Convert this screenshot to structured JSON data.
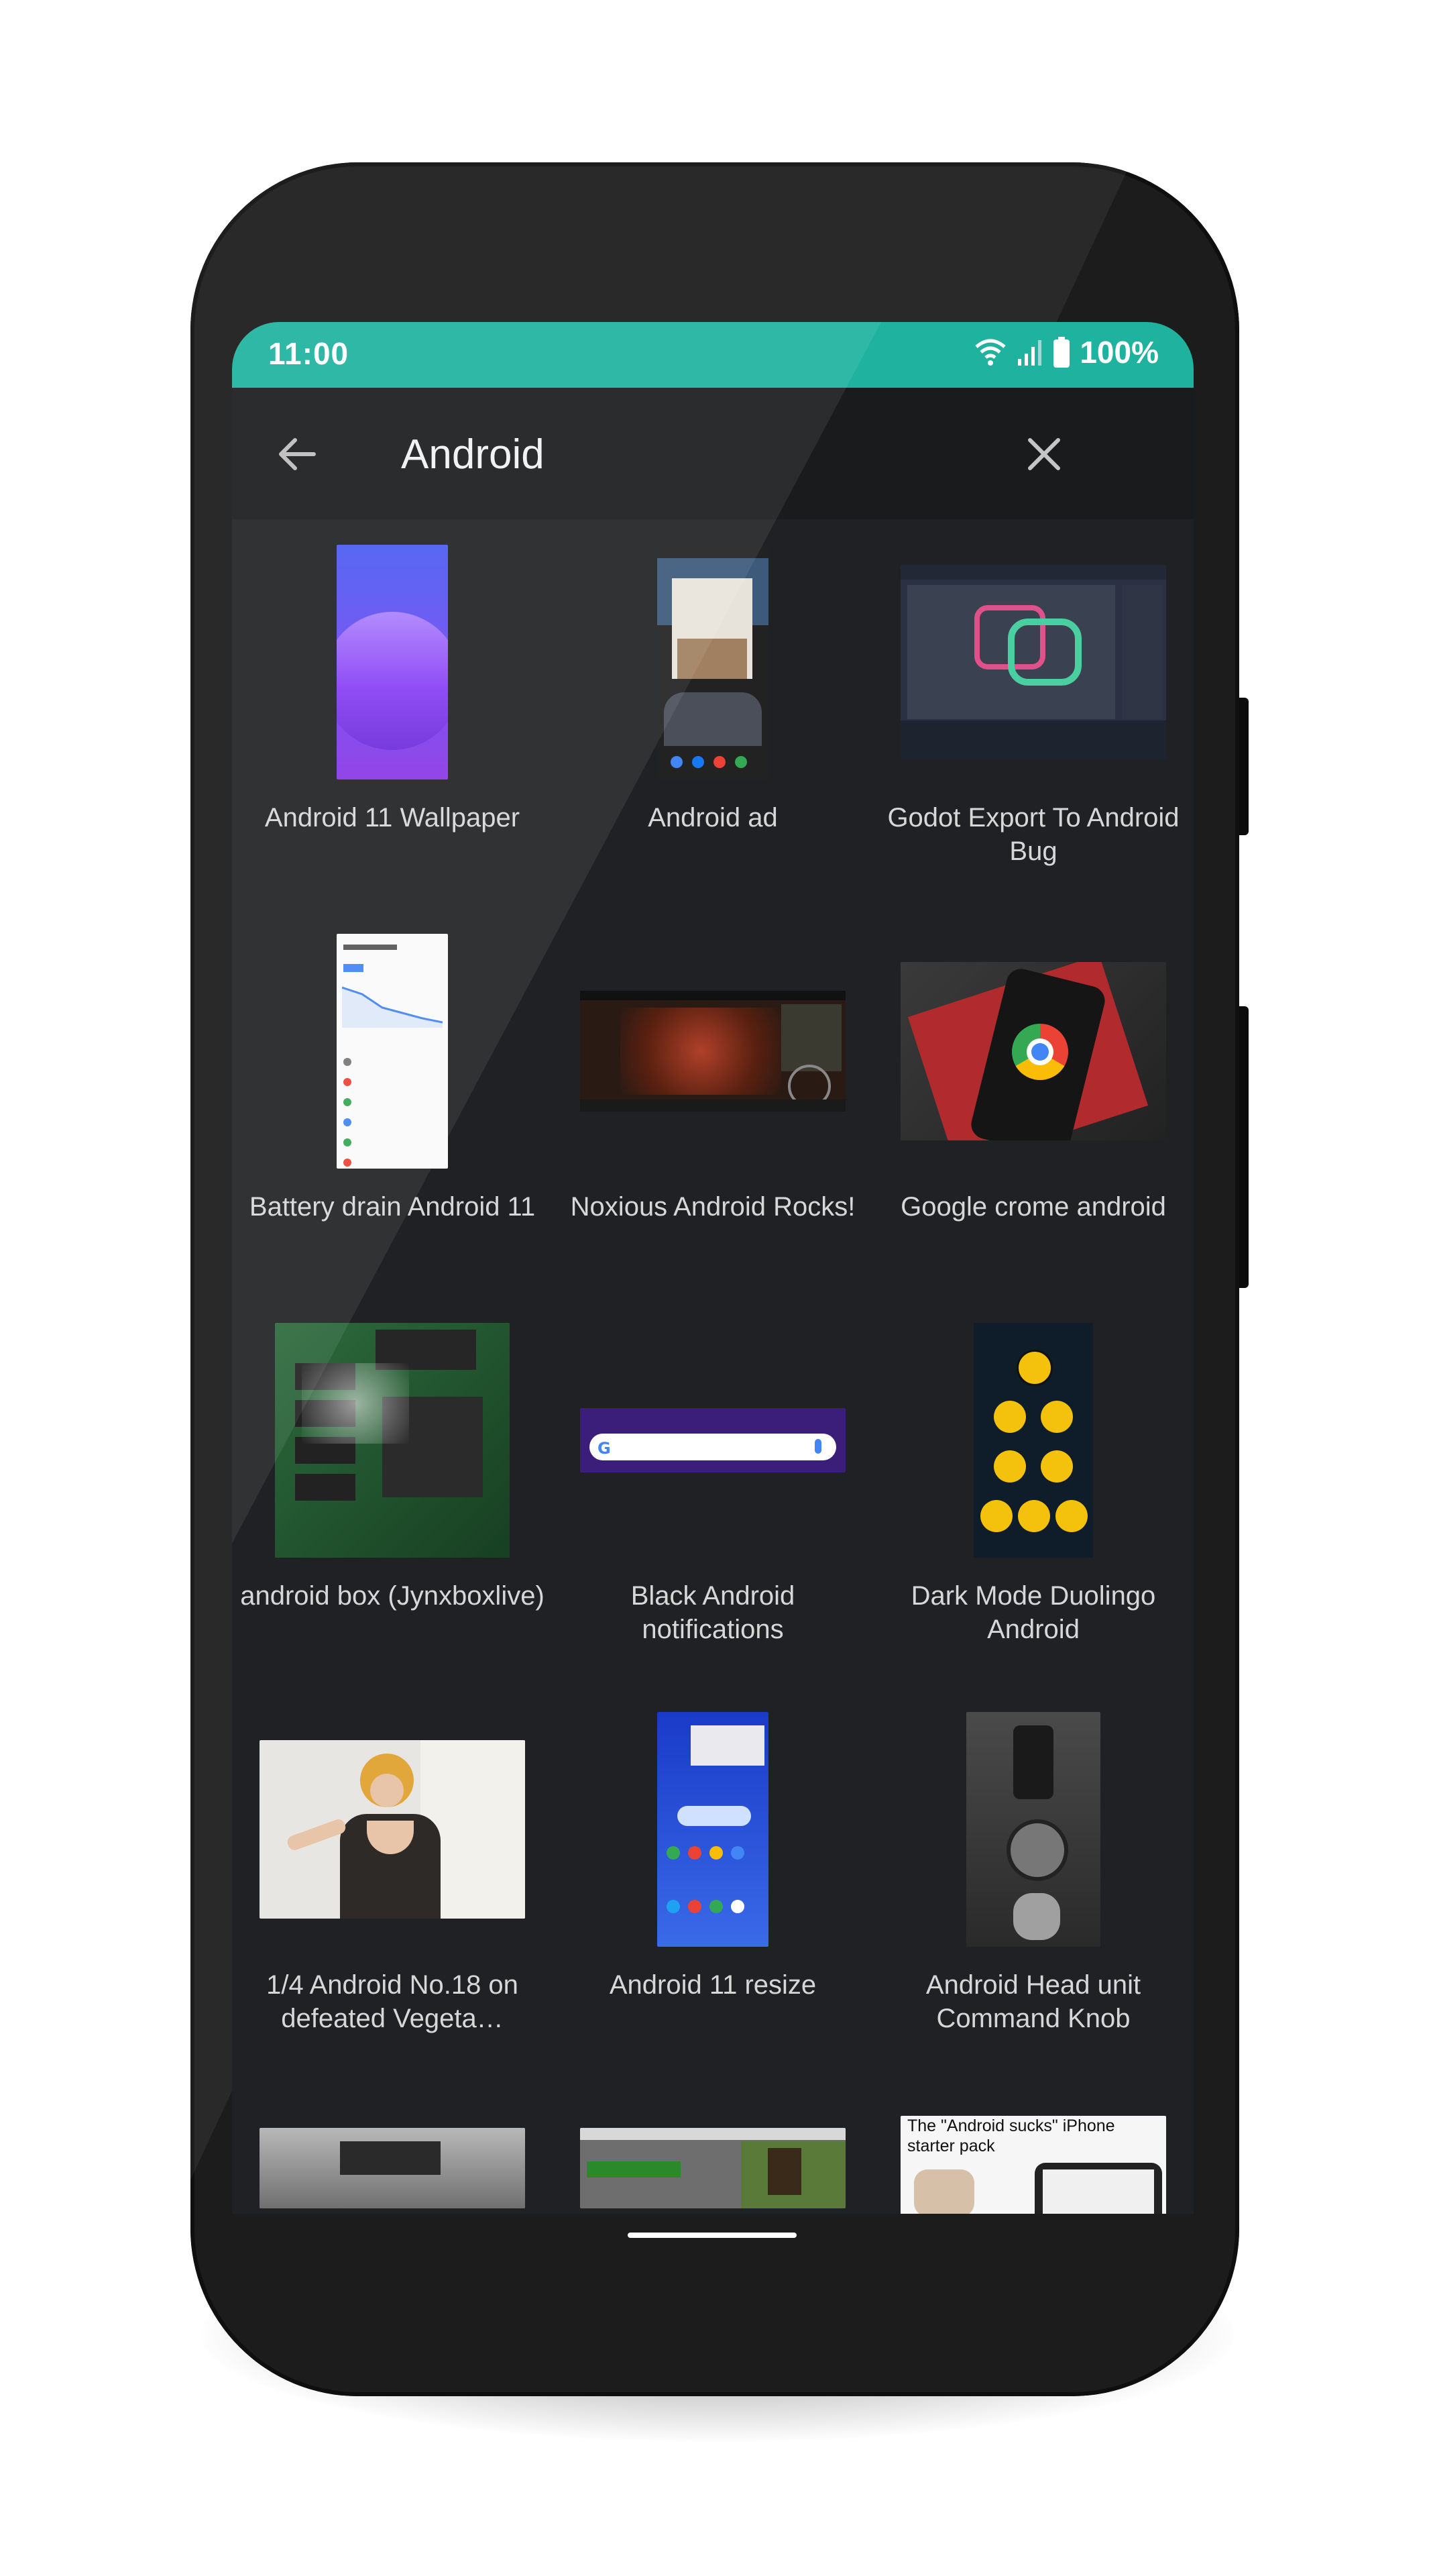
{
  "status_bar": {
    "time": "11:00",
    "battery": "100%",
    "icons": [
      "wifi-icon",
      "cell-signal-icon",
      "battery-icon"
    ],
    "color": "#1fb29f"
  },
  "search": {
    "query": "Android",
    "back_icon": "arrow-left-icon",
    "clear_icon": "close-icon"
  },
  "results": [
    {
      "caption": "Android 11 Wallpaper"
    },
    {
      "caption": "Android ad"
    },
    {
      "caption": "Godot Export To Android Bug"
    },
    {
      "caption": "Battery drain Android 11"
    },
    {
      "caption": "Noxious Android Rocks!"
    },
    {
      "caption": "Google crome android"
    },
    {
      "caption": "android box (Jynxboxlive)"
    },
    {
      "caption": "Black Android notifications"
    },
    {
      "caption": "Dark Mode Duolingo Android"
    },
    {
      "caption": "1/4 Android No.18 on defeated Vegeta…"
    },
    {
      "caption": "Android 11 resize"
    },
    {
      "caption": "Android Head unit Command Knob"
    },
    {
      "caption": ""
    },
    {
      "caption": ""
    },
    {
      "caption": "",
      "thumb_text": "The \"Android sucks\" iPhone starter pack"
    }
  ]
}
